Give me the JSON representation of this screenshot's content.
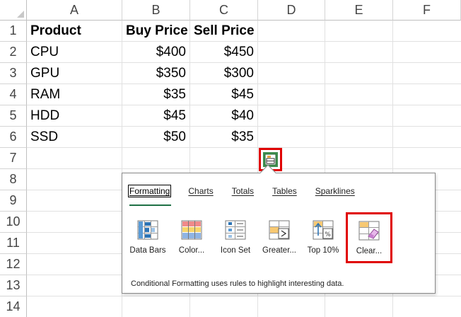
{
  "columns": [
    "A",
    "B",
    "C",
    "D",
    "E",
    "F"
  ],
  "rows": [
    "1",
    "2",
    "3",
    "4",
    "5",
    "6",
    "7",
    "8",
    "9",
    "10",
    "11",
    "12",
    "13",
    "14"
  ],
  "table": {
    "headers": [
      "Product",
      "Buy Price",
      "Sell Price"
    ],
    "data": [
      [
        "CPU",
        "$400",
        "$450"
      ],
      [
        "GPU",
        "$350",
        "$300"
      ],
      [
        "RAM",
        "$35",
        "$45"
      ],
      [
        "HDD",
        "$45",
        "$40"
      ],
      [
        "SSD",
        "$50",
        "$35"
      ]
    ]
  },
  "quick_analysis": {
    "button_icon": "quick-analysis-icon",
    "tabs": [
      "Formatting",
      "Charts",
      "Totals",
      "Tables",
      "Sparklines"
    ],
    "active_tab": "Formatting",
    "options": [
      {
        "label": "Data Bars",
        "icon": "data-bars-icon"
      },
      {
        "label": "Color...",
        "icon": "color-scale-icon"
      },
      {
        "label": "Icon Set",
        "icon": "icon-set-icon"
      },
      {
        "label": "Greater...",
        "icon": "greater-than-icon"
      },
      {
        "label": "Top 10%",
        "icon": "top-ten-percent-icon"
      },
      {
        "label": "Clear...",
        "icon": "clear-format-icon"
      }
    ],
    "selected_option": "Clear...",
    "description": "Conditional Formatting uses rules to highlight interesting data."
  },
  "colors": {
    "accent_green": "#1e7145",
    "highlight_red": "#e00000",
    "gridline": "#e1e1e1"
  }
}
